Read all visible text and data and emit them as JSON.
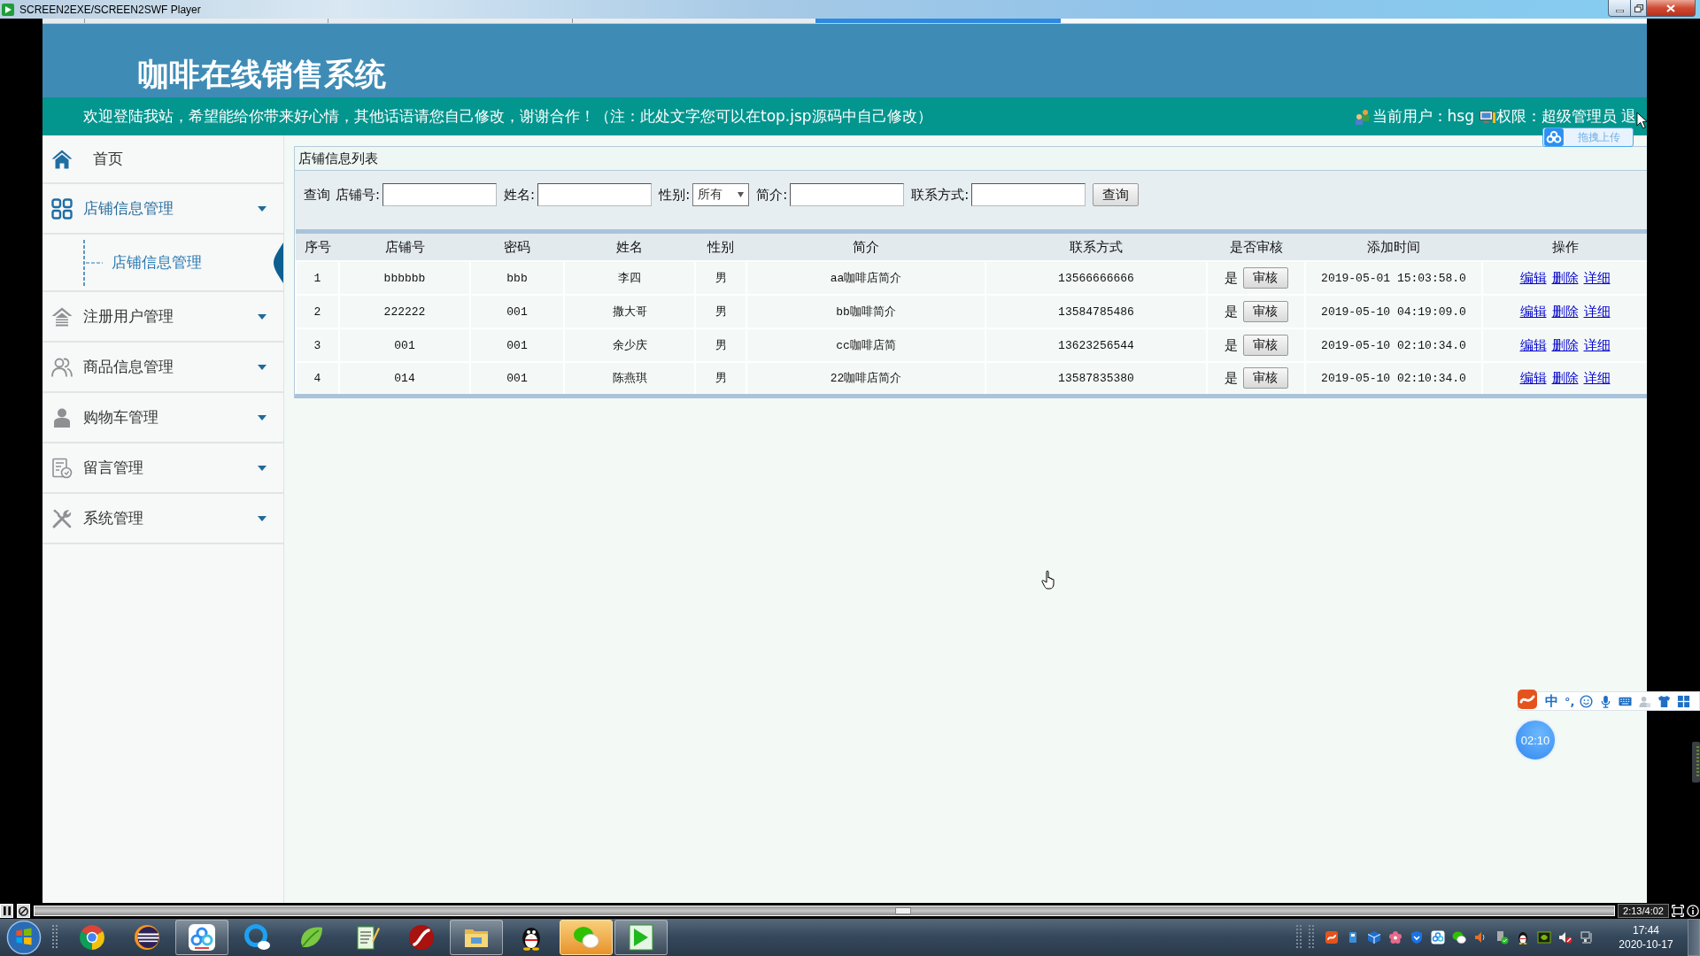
{
  "player_window": {
    "title": "SCREEN2EXE/SCREEN2SWF Player"
  },
  "site": {
    "title": "咖啡在线销售系统",
    "welcome": "欢迎登陆我站，希望能给你带来好心情，其他话语请您自己修改，谢谢合作！（注：此处文字您可以在top.jsp源码中自己修改）",
    "current_user": "当前用户：hsg",
    "role": "权限：超级管理员",
    "logout": "退"
  },
  "upload_widget": {
    "label": "拖拽上传"
  },
  "sidebar": {
    "items": [
      {
        "label": "首页",
        "kind": "link"
      },
      {
        "label": "店铺信息管理",
        "kind": "group",
        "expanded": true,
        "children": [
          {
            "label": "店铺信息管理",
            "selected": true
          }
        ]
      },
      {
        "label": "注册用户管理",
        "kind": "group",
        "expanded": false
      },
      {
        "label": "商品信息管理",
        "kind": "group",
        "expanded": false
      },
      {
        "label": "购物车管理",
        "kind": "group",
        "expanded": false
      },
      {
        "label": "留言管理",
        "kind": "group",
        "expanded": false
      },
      {
        "label": "系统管理",
        "kind": "group",
        "expanded": false
      }
    ]
  },
  "panel": {
    "title": "店铺信息列表",
    "search": {
      "label": "查询",
      "fields": [
        {
          "label": "店铺号:",
          "kind": "input"
        },
        {
          "label": "姓名:",
          "kind": "input"
        },
        {
          "label": "性别:",
          "kind": "select",
          "value": "所有"
        },
        {
          "label": "简介:",
          "kind": "input"
        },
        {
          "label": "联系方式:",
          "kind": "input"
        }
      ],
      "button": "查询"
    },
    "table": {
      "columns": [
        "序号",
        "店铺号",
        "密码",
        "姓名",
        "性别",
        "简介",
        "联系方式",
        "是否审核",
        "添加时间",
        "操作"
      ],
      "rows": [
        {
          "no": "1",
          "shop_no": "bbbbbb",
          "password": "bbb",
          "name": "李四",
          "gender": "男",
          "intro": "aa咖啡店简介",
          "phone": "13566666666",
          "audited": "是",
          "audit_button": "审核",
          "added_at": "2019-05-01 15:03:58.0",
          "actions": [
            "编辑",
            "删除",
            "详细"
          ]
        },
        {
          "no": "2",
          "shop_no": "222222",
          "password": "001",
          "name": "撒大哥",
          "gender": "男",
          "intro": "bb咖啡简介",
          "phone": "13584785486",
          "audited": "是",
          "audit_button": "审核",
          "added_at": "2019-05-10 04:19:09.0",
          "actions": [
            "编辑",
            "删除",
            "详细"
          ]
        },
        {
          "no": "3",
          "shop_no": "001",
          "password": "001",
          "name": "余少庆",
          "gender": "男",
          "intro": "cc咖啡店简",
          "phone": "13623256544",
          "audited": "是",
          "audit_button": "审核",
          "added_at": "2019-05-10 02:10:34.0",
          "actions": [
            "编辑",
            "删除",
            "详细"
          ]
        },
        {
          "no": "4",
          "shop_no": "014",
          "password": "001",
          "name": "陈燕琪",
          "gender": "男",
          "intro": "22咖啡店简介",
          "phone": "13587835380",
          "audited": "是",
          "audit_button": "审核",
          "added_at": "2019-05-10 02:10:34.0",
          "actions": [
            "编辑",
            "删除",
            "详细"
          ]
        }
      ]
    }
  },
  "ime_toolbar": {
    "mode": "中",
    "punctuation": "°,"
  },
  "timer": {
    "time": "02:10"
  },
  "player_controls": {
    "level": 0.55,
    "time": "2:13/4:02"
  },
  "taskbar": {
    "apps": [
      {
        "running": false,
        "attention": false
      },
      {
        "running": false,
        "attention": false
      },
      {
        "running": true,
        "attention": false
      },
      {
        "running": false,
        "attention": false
      },
      {
        "running": false,
        "attention": false
      },
      {
        "running": false,
        "attention": false
      },
      {
        "running": false,
        "attention": false
      },
      {
        "running": true,
        "attention": false
      },
      {
        "running": false,
        "attention": false
      },
      {
        "running": true,
        "attention": true
      },
      {
        "running": true,
        "attention": false
      }
    ],
    "clock": {
      "time": "17:44",
      "date": "2020-10-17"
    }
  }
}
